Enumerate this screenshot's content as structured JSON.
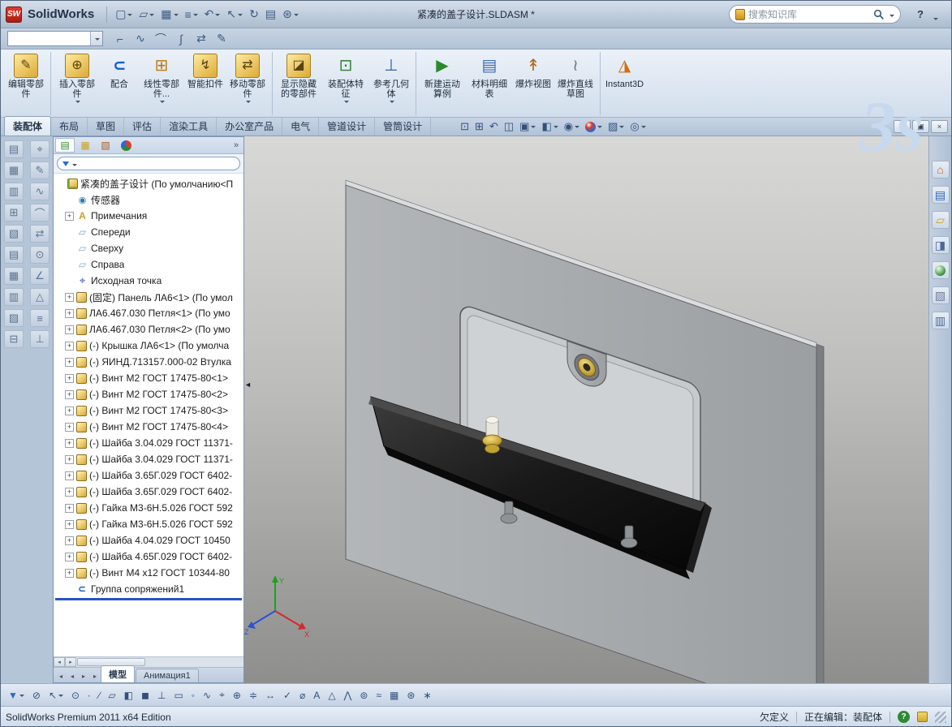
{
  "glyphs": {
    "dd": "▾",
    "overflow": "»",
    "collapse": "◄",
    "minimize": "−",
    "restore": "▣",
    "close": "×",
    "scroll_left": "◂",
    "scroll_right": "▸"
  },
  "titlebar": {
    "logo_text": "SW",
    "brand": "SolidWorks",
    "title": "紧凑的盖子设计.SLDASM *",
    "search": {
      "placeholder": "搜索知识库"
    },
    "help_glyph": "?",
    "icons": [
      {
        "name": "new-document-icon",
        "glyph": "▢",
        "arrow": true
      },
      {
        "name": "open-icon",
        "glyph": "▱",
        "arrow": true
      },
      {
        "name": "save-icon",
        "glyph": "▦",
        "arrow": true
      },
      {
        "name": "print-icon",
        "glyph": "≡",
        "arrow": true
      },
      {
        "name": "undo-icon",
        "glyph": "↶",
        "arrow": true
      },
      {
        "name": "select-icon",
        "glyph": "↖",
        "arrow": true
      },
      {
        "name": "rebuild-icon",
        "glyph": "↻",
        "arrow": false
      },
      {
        "name": "file-properties-icon",
        "glyph": "▤",
        "arrow": false
      },
      {
        "name": "options-icon",
        "glyph": "⊛",
        "arrow": true
      }
    ]
  },
  "quickrow": {
    "combo_value": "",
    "icons": [
      {
        "name": "fillet-tool-icon",
        "glyph": "⌐"
      },
      {
        "name": "spline-tool-icon",
        "glyph": "∿"
      },
      {
        "name": "arc-tool-icon",
        "glyph": "⌒"
      },
      {
        "name": "curve-tool-icon",
        "glyph": "∫"
      },
      {
        "name": "mirror-tool-icon",
        "glyph": "⇄"
      },
      {
        "name": "trim-tool-icon",
        "glyph": "✎"
      }
    ]
  },
  "ribbon": {
    "watermark": "3s",
    "buttons": [
      {
        "name": "edit-component-button",
        "label": "编辑零部件",
        "icon": "edit-component-icon",
        "glyph": "✎",
        "sep": true
      },
      {
        "name": "insert-components-button",
        "label": "插入零部件",
        "icon": "insert-component-icon",
        "glyph": "⊕",
        "arrow": true
      },
      {
        "name": "mate-button",
        "label": "配合",
        "icon": "mate-icon",
        "glyph": "∪"
      },
      {
        "name": "linear-component-pattern-button",
        "label": "线性零部件...",
        "icon": "linear-pattern-icon",
        "glyph": "⊞",
        "arrow": true
      },
      {
        "name": "smart-fasteners-button",
        "label": "智能扣件",
        "icon": "smart-fasteners-icon",
        "glyph": "↯"
      },
      {
        "name": "move-component-button",
        "label": "移动零部件",
        "icon": "move-component-icon",
        "glyph": "⇄",
        "arrow": true,
        "sep": true
      },
      {
        "name": "show-hidden-components-button",
        "label": "显示隐藏的零部件",
        "icon": "show-hidden-components-icon",
        "glyph": "◪"
      },
      {
        "name": "assembly-features-button",
        "label": "装配体特征",
        "icon": "assembly-features-icon",
        "glyph": "⊡",
        "arrow": true
      },
      {
        "name": "reference-geometry-button",
        "label": "参考几何体",
        "icon": "reference-geometry-icon",
        "glyph": "⊥",
        "arrow": true,
        "sep": true
      },
      {
        "name": "new-motion-study-button",
        "label": "新建运动算例",
        "icon": "motion-study-icon",
        "glyph": "▶"
      },
      {
        "name": "bill-of-materials-button",
        "label": "材料明细表",
        "icon": "bom-icon",
        "glyph": "▤"
      },
      {
        "name": "exploded-view-button",
        "label": "爆炸视图",
        "icon": "exploded-view-icon",
        "glyph": "↟"
      },
      {
        "name": "explode-line-sketch-button",
        "label": "爆炸直线草图",
        "icon": "explode-line-sketch-icon",
        "glyph": "≀",
        "sep": true
      },
      {
        "name": "instant3d-button",
        "label": "Instant3D",
        "icon": "instant3d-icon",
        "glyph": "◮"
      }
    ]
  },
  "tabs": {
    "items": [
      {
        "name": "tab-assembly",
        "label": "装配体",
        "active": true
      },
      {
        "name": "tab-layout",
        "label": "布局"
      },
      {
        "name": "tab-sketch",
        "label": "草图"
      },
      {
        "name": "tab-evaluate",
        "label": "评估"
      },
      {
        "name": "tab-render-tools",
        "label": "渲染工具"
      },
      {
        "name": "tab-office-products",
        "label": "办公室产品"
      },
      {
        "name": "tab-electrical",
        "label": "电气"
      },
      {
        "name": "tab-piping",
        "label": "管道设计"
      },
      {
        "name": "tab-tubing",
        "label": "管筒设计"
      }
    ]
  },
  "viewbar": {
    "items": [
      {
        "name": "zoom-fit-icon",
        "glyph": "⊡"
      },
      {
        "name": "zoom-area-icon",
        "glyph": "⊞"
      },
      {
        "name": "previous-view-icon",
        "glyph": "↶"
      },
      {
        "name": "section-view-icon",
        "glyph": "◫"
      },
      {
        "name": "view-orientation-icon",
        "glyph": "▣",
        "arrow": true
      },
      {
        "name": "display-style-icon",
        "glyph": "◧",
        "arrow": true
      },
      {
        "name": "hide-show-items-icon",
        "glyph": "◉",
        "arrow": true
      },
      {
        "name": "edit-appearance-icon",
        "glyph": "",
        "arrow": true
      },
      {
        "name": "apply-scene-icon",
        "glyph": "▨",
        "arrow": true
      },
      {
        "name": "view-settings-icon",
        "glyph": "◎",
        "arrow": true
      }
    ]
  },
  "leftdock": {
    "col1": [
      {
        "name": "left-toolbar-icon",
        "glyph": "▤"
      },
      {
        "name": "left-toolbar-icon",
        "glyph": "▦"
      },
      {
        "name": "left-toolbar-icon",
        "glyph": "▥"
      },
      {
        "name": "left-toolbar-icon",
        "glyph": "⊞"
      },
      {
        "name": "left-toolbar-icon",
        "glyph": "▧"
      },
      {
        "name": "left-toolbar-icon",
        "glyph": "▤"
      },
      {
        "name": "left-toolbar-icon",
        "glyph": "▦"
      },
      {
        "name": "left-toolbar-icon",
        "glyph": "▥"
      },
      {
        "name": "left-toolbar-icon",
        "glyph": "▨"
      },
      {
        "name": "left-toolbar-icon",
        "glyph": "⊟"
      }
    ],
    "col2": [
      {
        "name": "left-toolbar-icon",
        "glyph": "⌖"
      },
      {
        "name": "left-toolbar-icon",
        "glyph": "✎"
      },
      {
        "name": "left-toolbar-icon",
        "glyph": "∿"
      },
      {
        "name": "left-toolbar-icon",
        "glyph": "⌒"
      },
      {
        "name": "left-toolbar-icon",
        "glyph": "⇄"
      },
      {
        "name": "left-toolbar-icon",
        "glyph": "⊙"
      },
      {
        "name": "left-toolbar-icon",
        "glyph": "∠"
      },
      {
        "name": "left-toolbar-icon",
        "glyph": "△"
      },
      {
        "name": "left-toolbar-icon",
        "glyph": "≡"
      },
      {
        "name": "left-toolbar-icon",
        "glyph": "⊥"
      }
    ]
  },
  "panel": {
    "tabs": [
      {
        "name": "featuremanager-tab-icon",
        "glyph": "▤"
      },
      {
        "name": "propertymanager-tab-icon",
        "glyph": "▦"
      },
      {
        "name": "configurationmanager-tab-icon",
        "glyph": "▧"
      },
      {
        "name": "displaymanager-tab-icon",
        "glyph": ""
      }
    ],
    "nav": [
      {
        "name": "go-first-tab-button",
        "glyph": "◂"
      },
      {
        "name": "prev-tab-button",
        "glyph": "◂"
      },
      {
        "name": "next-tab-button",
        "glyph": "▸"
      },
      {
        "name": "go-last-tab-button",
        "glyph": "▸"
      }
    ],
    "bottom_tabs": [
      {
        "name": "tab-model",
        "label": "模型",
        "active": true
      },
      {
        "name": "tab-animation1",
        "label": "Анимация1"
      }
    ]
  },
  "tree": {
    "items": [
      {
        "root": true,
        "text": "紧凑的盖子设计 (По умолчанию<П",
        "icon": "assembly-icon",
        "exp": ""
      },
      {
        "text": "传感器",
        "icon": "sensors-icon",
        "exp": ""
      },
      {
        "text": "Примечания",
        "icon": "annotations-icon",
        "exp": "+"
      },
      {
        "text": "Спереди",
        "icon": "plane-icon",
        "exp": ""
      },
      {
        "text": "Сверху",
        "icon": "plane-icon",
        "exp": ""
      },
      {
        "text": "Справа",
        "icon": "plane-icon",
        "exp": ""
      },
      {
        "text": "Исходная точка",
        "icon": "origin-icon",
        "exp": ""
      },
      {
        "text": "(固定) Панель ЛА6<1> (По умол",
        "icon": "component-icon",
        "exp": "+"
      },
      {
        "text": "ЛА6.467.030 Петля<1> (По умо",
        "icon": "component-icon",
        "exp": "+"
      },
      {
        "text": "ЛА6.467.030 Петля<2> (По умо",
        "icon": "component-icon",
        "exp": "+"
      },
      {
        "text": "(-) Крышка ЛА6<1> (По умолча",
        "icon": "component-icon",
        "exp": "+"
      },
      {
        "text": "(-) ЯИНД.713157.000-02 Втулка",
        "icon": "component-icon",
        "exp": "+"
      },
      {
        "text": "(-) Винт М2 ГОСТ 17475-80<1>",
        "icon": "component-icon",
        "exp": "+"
      },
      {
        "text": "(-) Винт М2 ГОСТ 17475-80<2>",
        "icon": "component-icon",
        "exp": "+"
      },
      {
        "text": "(-) Винт М2 ГОСТ 17475-80<3>",
        "icon": "component-icon",
        "exp": "+"
      },
      {
        "text": "(-) Винт М2 ГОСТ 17475-80<4>",
        "icon": "component-icon",
        "exp": "+"
      },
      {
        "text": "(-) Шайба 3.04.029 ГОСТ 11371-",
        "icon": "component-icon",
        "exp": "+"
      },
      {
        "text": "(-) Шайба 3.04.029 ГОСТ 11371-",
        "icon": "component-icon",
        "exp": "+"
      },
      {
        "text": "(-) Шайба 3.65Г.029 ГОСТ 6402-",
        "icon": "component-icon",
        "exp": "+"
      },
      {
        "text": "(-) Шайба 3.65Г.029 ГОСТ 6402-",
        "icon": "component-icon",
        "exp": "+"
      },
      {
        "text": "(-) Гайка М3-6Н.5.026 ГОСТ 592",
        "icon": "component-icon",
        "exp": "+"
      },
      {
        "text": "(-) Гайка М3-6Н.5.026 ГОСТ 592",
        "icon": "component-icon",
        "exp": "+"
      },
      {
        "text": "(-) Шайба 4.04.029 ГОСТ 10450",
        "icon": "component-icon",
        "exp": "+"
      },
      {
        "text": "(-) Шайба 4.65Г.029 ГОСТ 6402-",
        "icon": "component-icon",
        "exp": "+"
      },
      {
        "text": "(-) Винт М4 х12 ГОСТ 10344-80",
        "icon": "component-icon",
        "exp": "+"
      },
      {
        "text": "Группа сопряжений1",
        "icon": "mategroup-icon",
        "exp": ""
      }
    ]
  },
  "viewport": {
    "triad": {
      "x": "X",
      "y": "Y",
      "z": "Z"
    }
  },
  "taskpane": [
    {
      "name": "solidworks-resources-icon",
      "glyph": "⌂"
    },
    {
      "name": "design-library-icon",
      "glyph": "▤"
    },
    {
      "name": "file-explorer-icon",
      "glyph": "▱"
    },
    {
      "name": "view-palette-icon",
      "glyph": "◨"
    },
    {
      "name": "appearances-icon",
      "glyph": ""
    },
    {
      "name": "scenes-icon",
      "glyph": "▨"
    },
    {
      "name": "custom-properties-icon",
      "glyph": "▥"
    }
  ],
  "bottombar": {
    "items": [
      {
        "name": "selection-filter-toggle-icon",
        "glyph": "▼",
        "arrow": true
      },
      {
        "name": "clear-all-filters-icon",
        "glyph": "⊘"
      },
      {
        "name": "select-tool-icon",
        "glyph": "↖",
        "arrow": true
      },
      {
        "name": "magnified-selection-icon",
        "glyph": "⊙"
      },
      {
        "name": "filter-vertices-icon",
        "glyph": "∙"
      },
      {
        "name": "filter-edges-icon",
        "glyph": "∕"
      },
      {
        "name": "filter-faces-icon",
        "glyph": "▱"
      },
      {
        "name": "filter-surface-bodies-icon",
        "glyph": "◧"
      },
      {
        "name": "filter-solid-bodies-icon",
        "glyph": "◼"
      },
      {
        "name": "filter-axes-icon",
        "glyph": "⊥"
      },
      {
        "name": "filter-planes-icon",
        "glyph": "▭"
      },
      {
        "name": "filter-sketch-points-icon",
        "glyph": "◦"
      },
      {
        "name": "filter-sketch-segments-icon",
        "glyph": "∿"
      },
      {
        "name": "filter-midpoints-icon",
        "glyph": "⌖"
      },
      {
        "name": "filter-center-marks-icon",
        "glyph": "⊕"
      },
      {
        "name": "filter-centerlines-icon",
        "glyph": "≑"
      },
      {
        "name": "filter-dimensions-icon",
        "glyph": "↔"
      },
      {
        "name": "filter-surface-finish-icon",
        "glyph": "✓"
      },
      {
        "name": "filter-geometric-tolerances-icon",
        "glyph": "⌀"
      },
      {
        "name": "filter-notes-icon",
        "glyph": "A"
      },
      {
        "name": "filter-datums-icon",
        "glyph": "△"
      },
      {
        "name": "filter-weld-symbols-icon",
        "glyph": "⋀"
      },
      {
        "name": "filter-datum-targets-icon",
        "glyph": "⊚"
      },
      {
        "name": "filter-cosmetic-threads-icon",
        "glyph": "≈"
      },
      {
        "name": "filter-blocks-icon",
        "glyph": "▦"
      },
      {
        "name": "filter-connection-points-icon",
        "glyph": "⊛"
      },
      {
        "name": "filter-routing-points-icon",
        "glyph": "∗"
      }
    ]
  },
  "statusbar": {
    "edition": "SolidWorks Premium 2011 x64 Edition",
    "state": "欠定义",
    "editing": "正在编辑：装配体",
    "help_glyph": "?"
  }
}
